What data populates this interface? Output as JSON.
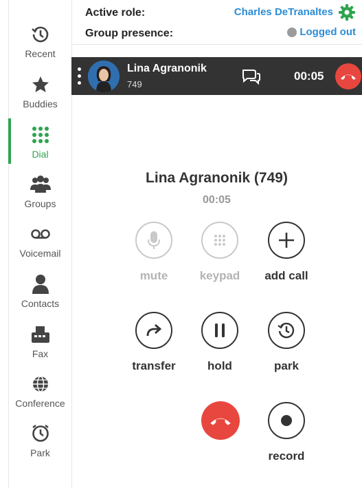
{
  "sidebar": {
    "items": [
      {
        "label": "Recent",
        "icon": "clock-history-icon"
      },
      {
        "label": "Buddies",
        "icon": "star-icon"
      },
      {
        "label": "Dial",
        "icon": "dialpad-icon"
      },
      {
        "label": "Groups",
        "icon": "group-icon"
      },
      {
        "label": "Voicemail",
        "icon": "voicemail-icon"
      },
      {
        "label": "Contacts",
        "icon": "contact-person-icon"
      },
      {
        "label": "Fax",
        "icon": "fax-icon"
      },
      {
        "label": "Conference",
        "icon": "globe-icon"
      },
      {
        "label": "Park",
        "icon": "park-clock-icon"
      }
    ],
    "active": "Dial"
  },
  "header": {
    "active_role_label": "Active role:",
    "active_role_value": "Charles DeTranaltes",
    "group_presence_label": "Group presence:",
    "group_presence_value": "Logged out"
  },
  "call_bar": {
    "name": "Lina Agranonik",
    "extension": "749",
    "timer": "00:05"
  },
  "call_panel": {
    "title": "Lina Agranonik (749)",
    "timer": "00:05",
    "controls": {
      "mute": "mute",
      "keypad": "keypad",
      "add_call": "add call",
      "transfer": "transfer",
      "hold": "hold",
      "park": "park",
      "record": "record"
    }
  },
  "colors": {
    "accent_green": "#2ea44f",
    "link_blue": "#2b8dd6",
    "hangup_red": "#e8473f",
    "call_bar_bg": "#333333"
  }
}
